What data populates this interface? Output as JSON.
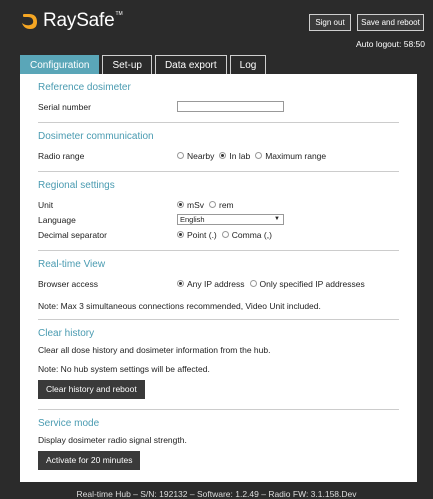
{
  "header": {
    "logo_text": "RaySafe",
    "logo_tm": "TM",
    "sign_out": "Sign out",
    "save_reboot": "Save and reboot",
    "auto_logout": "Auto logout: 58:50",
    "accent_color": "#f5a623"
  },
  "tabs": [
    {
      "label": "Configuration",
      "active": true
    },
    {
      "label": "Set-up",
      "active": false
    },
    {
      "label": "Data export",
      "active": false
    },
    {
      "label": "Log",
      "active": false
    }
  ],
  "reference": {
    "title": "Reference dosimeter",
    "serial_label": "Serial number",
    "serial_value": ""
  },
  "communication": {
    "title": "Dosimeter communication",
    "radio_label": "Radio range",
    "options": [
      "Nearby",
      "In lab",
      "Maximum range"
    ],
    "selected": 1
  },
  "regional": {
    "title": "Regional settings",
    "unit_label": "Unit",
    "unit_options": [
      "mSv",
      "rem"
    ],
    "unit_selected": 0,
    "language_label": "Language",
    "language_value": "English",
    "decimal_label": "Decimal separator",
    "decimal_options": [
      "Point (.)",
      "Comma (,)"
    ],
    "decimal_selected": 0
  },
  "realtime": {
    "title": "Real-time View",
    "browser_label": "Browser access",
    "options": [
      "Any IP address",
      "Only specified IP addresses"
    ],
    "selected": 0,
    "note": "Note: Max 3 simultaneous connections recommended, Video Unit included."
  },
  "clear": {
    "title": "Clear history",
    "desc": "Clear all dose history and dosimeter information from the hub.",
    "note": "Note: No hub system settings will be affected.",
    "button": "Clear history and reboot"
  },
  "service": {
    "title": "Service mode",
    "desc": "Display dosimeter radio signal strength.",
    "button": "Activate for 20 minutes"
  },
  "footer": "Real-time Hub – S/N: 192132 – Software: 1.2.49 – Radio FW: 3.1.158.Dev"
}
